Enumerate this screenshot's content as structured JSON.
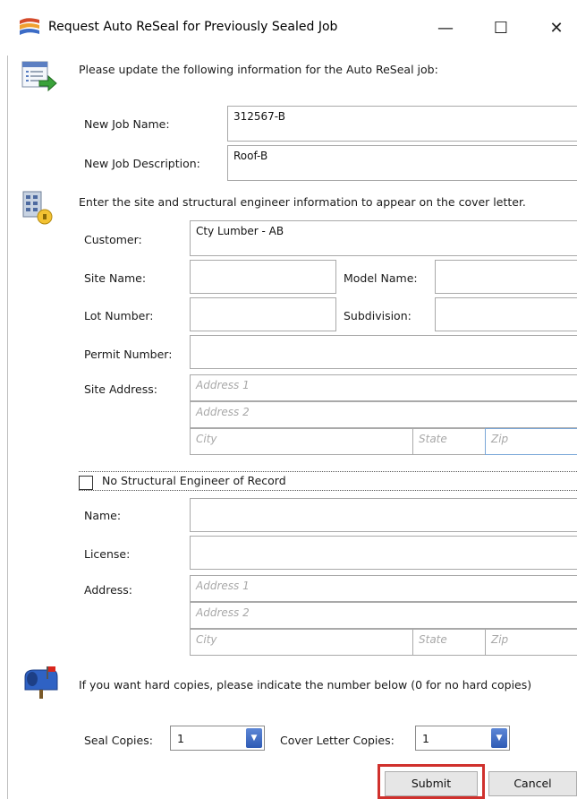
{
  "window": {
    "title": "Request Auto ReSeal for Previously Sealed Job",
    "minimize_glyph": "—",
    "maximize_glyph": "☐",
    "close_glyph": "✕"
  },
  "job_section": {
    "instruction": "Please update the following information for the Auto ReSeal job:",
    "job_name_label": "New Job Name:",
    "job_name_value": "312567-B",
    "job_description_label": "New Job Description:",
    "job_description_value": "Roof-B"
  },
  "site_section": {
    "instruction": "Enter the site and structural engineer information to appear on the cover letter.",
    "customer_label": "Customer:",
    "customer_value": "Cty Lumber - AB",
    "site_name_label": "Site Name:",
    "site_name_value": "",
    "model_name_label": "Model Name:",
    "model_name_value": "",
    "lot_number_label": "Lot Number:",
    "lot_number_value": "",
    "subdivision_label": "Subdivision:",
    "subdivision_value": "",
    "permit_number_label": "Permit Number:",
    "permit_number_value": "",
    "site_address_label": "Site Address:",
    "address1_placeholder": "Address 1",
    "address2_placeholder": "Address 2",
    "city_placeholder": "City",
    "state_placeholder": "State",
    "zip_placeholder": "Zip"
  },
  "engineer_section": {
    "no_engineer_label": "No Structural Engineer of Record",
    "no_engineer_checked": false,
    "name_label": "Name:",
    "name_value": "",
    "license_label": "License:",
    "license_value": "",
    "address_label": "Address:",
    "address1_placeholder": "Address 1",
    "address2_placeholder": "Address 2",
    "city_placeholder": "City",
    "state_placeholder": "State",
    "zip_placeholder": "Zip"
  },
  "copies_section": {
    "instruction": "If you want hard copies, please indicate the number below (0 for no hard copies)",
    "seal_copies_label": "Seal Copies:",
    "seal_copies_value": "1",
    "cover_letter_copies_label": "Cover Letter Copies:",
    "cover_letter_copies_value": "1"
  },
  "buttons": {
    "submit_label": "Submit",
    "cancel_label": "Cancel"
  },
  "icons": {
    "app": "reseal-app-icon",
    "job": "form-arrow-icon",
    "site": "building-lock-icon",
    "copies": "mailbox-icon",
    "combo_arrow": "dropdown-arrow-icon"
  },
  "colors": {
    "submit_highlight": "#d0312d",
    "combo_arrow": "#3c6cc6"
  }
}
